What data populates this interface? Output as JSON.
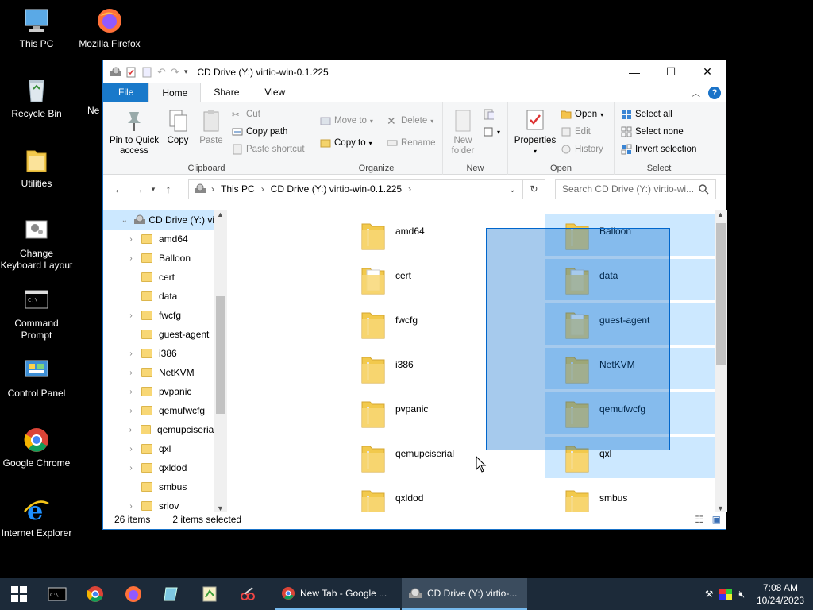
{
  "desktop": {
    "icons": [
      {
        "label": "This PC"
      },
      {
        "label": "Mozilla Firefox"
      },
      {
        "label": "Recycle Bin"
      },
      {
        "label": "Ne"
      },
      {
        "label": "Utilities"
      },
      {
        "label": "Change Keyboard Layout"
      },
      {
        "label": "Command Prompt"
      },
      {
        "label": "Control Panel"
      },
      {
        "label": "Google Chrome"
      },
      {
        "label": "Internet Explorer"
      }
    ]
  },
  "window": {
    "title": "CD Drive (Y:) virtio-win-0.1.225",
    "tabs": {
      "file": "File",
      "home": "Home",
      "share": "Share",
      "view": "View"
    },
    "ribbon": {
      "clipboard": {
        "name": "Clipboard",
        "pin": "Pin to Quick access",
        "copy": "Copy",
        "paste": "Paste",
        "cut": "Cut",
        "copy_path": "Copy path",
        "paste_shortcut": "Paste shortcut"
      },
      "organize": {
        "name": "Organize",
        "move_to": "Move to",
        "copy_to": "Copy to",
        "delete": "Delete",
        "rename": "Rename"
      },
      "new": {
        "name": "New",
        "new_folder": "New folder"
      },
      "open": {
        "name": "Open",
        "properties": "Properties",
        "open": "Open",
        "edit": "Edit",
        "history": "History"
      },
      "select": {
        "name": "Select",
        "select_all": "Select all",
        "select_none": "Select none",
        "invert": "Invert selection"
      }
    },
    "address": {
      "this_pc": "This PC",
      "drive": "CD Drive (Y:) virtio-win-0.1.225",
      "search_placeholder": "Search CD Drive (Y:) virtio-wi..."
    },
    "navpane": {
      "root": "CD Drive (Y:) vi",
      "items": [
        "amd64",
        "Balloon",
        "cert",
        "data",
        "fwcfg",
        "guest-agent",
        "i386",
        "NetKVM",
        "pvpanic",
        "qemufwcfg",
        "qemupciserial",
        "qxl",
        "qxldod",
        "smbus",
        "sriov"
      ]
    },
    "content": {
      "left": [
        "amd64",
        "cert",
        "fwcfg",
        "i386",
        "pvpanic",
        "qemupciserial",
        "qxldod"
      ],
      "right": [
        "Balloon",
        "data",
        "guest-agent",
        "NetKVM",
        "qemufwcfg",
        "qxl",
        "smbus"
      ]
    },
    "status": {
      "count": "26 items",
      "selected": "2 items selected"
    }
  },
  "taskbar": {
    "tasks": [
      {
        "label": "New Tab - Google ..."
      },
      {
        "label": "CD Drive (Y:) virtio-..."
      }
    ],
    "time": "7:08 AM",
    "date": "10/24/2023"
  }
}
